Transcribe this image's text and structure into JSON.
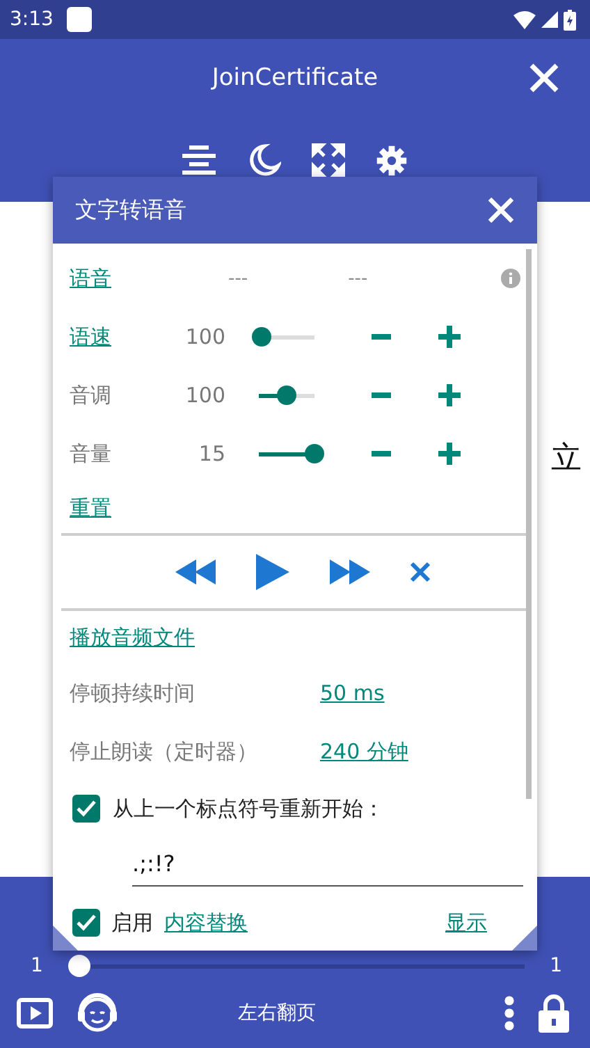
{
  "status_bar": {
    "time": "3:13"
  },
  "app_bar": {
    "title": "JoinCertificate"
  },
  "document": {
    "right_chars": [
      "立"
    ]
  },
  "dialog": {
    "title": "文字转语音",
    "voice": {
      "label": "语音",
      "value_1": "---",
      "value_2": "---"
    },
    "sliders": [
      {
        "label": "语速",
        "link": true,
        "value": "100",
        "level": 0.05
      },
      {
        "label": "音调",
        "link": false,
        "value": "100",
        "level": 0.5
      },
      {
        "label": "音量",
        "link": false,
        "value": "15",
        "level": 1
      }
    ],
    "reset": "重置",
    "play_file": "播放音频文件",
    "settings": [
      {
        "label": "停顿持续时间",
        "value": "50 ms"
      },
      {
        "label": "停止朗读（定时器）",
        "value": "240 分钟"
      }
    ],
    "restart": {
      "label": "从上一个标点符号重新开始：",
      "checked": true,
      "value": ".;:!?"
    },
    "replace": {
      "checked": true,
      "label": "启用",
      "link": "内容替换",
      "show": "显示"
    }
  },
  "bottom_bar": {
    "page_start": "1",
    "page_end": "1",
    "level": 0,
    "mode": "左右翻页"
  }
}
